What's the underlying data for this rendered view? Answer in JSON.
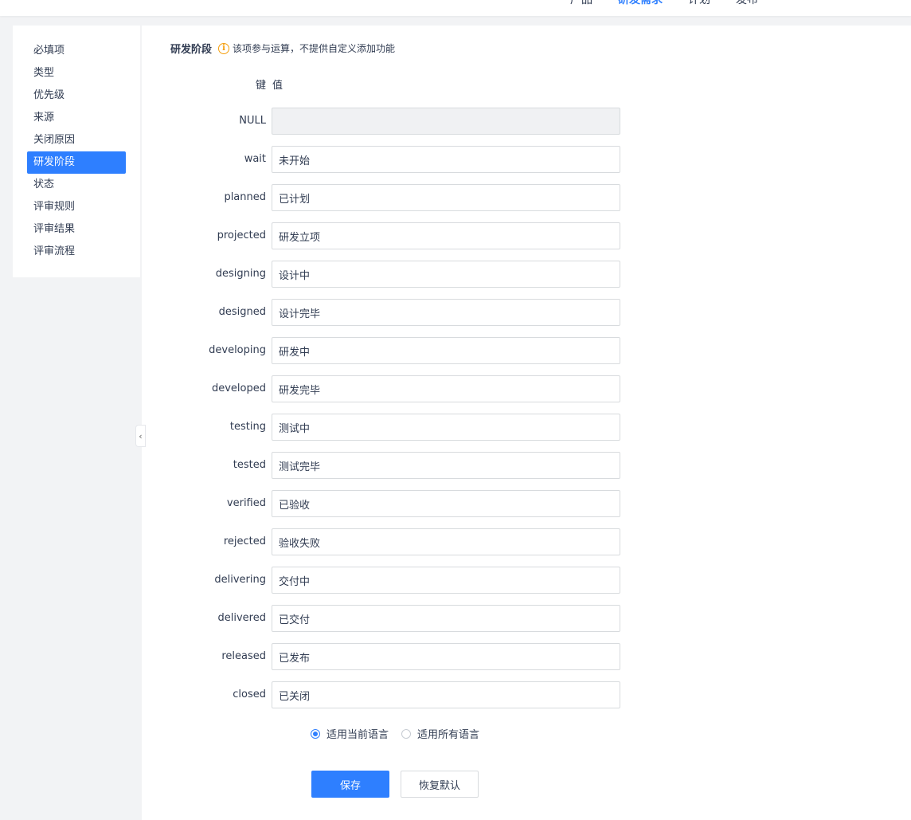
{
  "topnav": {
    "items": [
      {
        "label": "产品"
      },
      {
        "label": "研发需求"
      },
      {
        "label": "计划"
      },
      {
        "label": "发布"
      }
    ]
  },
  "sidebar": {
    "items": [
      {
        "label": "必填项"
      },
      {
        "label": "类型"
      },
      {
        "label": "优先级"
      },
      {
        "label": "来源"
      },
      {
        "label": "关闭原因"
      },
      {
        "label": "研发阶段"
      },
      {
        "label": "状态"
      },
      {
        "label": "评审规则"
      },
      {
        "label": "评审结果"
      },
      {
        "label": "评审流程"
      }
    ],
    "active": "研发阶段"
  },
  "section": {
    "title": "研发阶段",
    "hint": "该项参与运算，不提供自定义添加功能",
    "key_header": "键",
    "value_header": "值"
  },
  "rows": [
    {
      "key": "NULL",
      "value": ""
    },
    {
      "key": "wait",
      "value": "未开始"
    },
    {
      "key": "planned",
      "value": "已计划"
    },
    {
      "key": "projected",
      "value": "研发立项"
    },
    {
      "key": "designing",
      "value": "设计中"
    },
    {
      "key": "designed",
      "value": "设计完毕"
    },
    {
      "key": "developing",
      "value": "研发中"
    },
    {
      "key": "developed",
      "value": "研发完毕"
    },
    {
      "key": "testing",
      "value": "测试中"
    },
    {
      "key": "tested",
      "value": "测试完毕"
    },
    {
      "key": "verified",
      "value": "已验收"
    },
    {
      "key": "rejected",
      "value": "验收失败"
    },
    {
      "key": "delivering",
      "value": "交付中"
    },
    {
      "key": "delivered",
      "value": "已交付"
    },
    {
      "key": "released",
      "value": "已发布"
    },
    {
      "key": "closed",
      "value": "已关闭"
    }
  ],
  "language": {
    "options": [
      "适用当前语言",
      "适用所有语言"
    ],
    "selected": "适用当前语言"
  },
  "buttons": {
    "save": "保存",
    "reset": "恢复默认"
  },
  "colors": {
    "accent": "#2e7fff",
    "warning": "#f59e0b"
  }
}
